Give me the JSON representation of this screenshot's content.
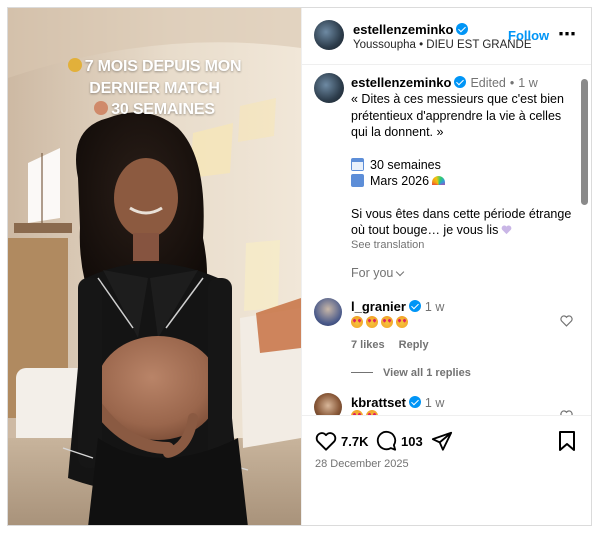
{
  "media": {
    "overlay_line1": "7 MOIS DEPUIS MON",
    "overlay_line2": "DERNIER MATCH",
    "overlay_line3": "30 SEMAINES"
  },
  "post_header": {
    "username": "estellenzeminko",
    "subtitle": "Youssoupha • DIEU EST GRANDE",
    "follow_label": "Follow",
    "more_icon": "more-horizontal-icon"
  },
  "caption": {
    "username": "estellenzeminko",
    "edited": "Edited",
    "separator": "•",
    "time": "1 w",
    "quote": "« Dites à ces messieurs que c'est bien prétentieux d'apprendre la vie à celles qui la donnent. »",
    "line_weeks": "30 semaines",
    "line_date": "Mars 2026",
    "closing": "Si vous êtes dans cette période étrange où tout bouge… je vous lis",
    "see_translation": "See translation",
    "for_you": "For you"
  },
  "comments": [
    {
      "username": "l_granier",
      "time": "1 w",
      "likes_label": "7 likes",
      "reply_label": "Reply",
      "view_replies_label": "View all 1 replies"
    },
    {
      "username": "kbrattset",
      "time": "1 w"
    }
  ],
  "actions": {
    "likes_count": "7.7K",
    "comments_count": "103",
    "date": "28 December 2025"
  },
  "colors": {
    "accent": "#0095f6",
    "muted": "#737373",
    "border": "#efefef"
  }
}
